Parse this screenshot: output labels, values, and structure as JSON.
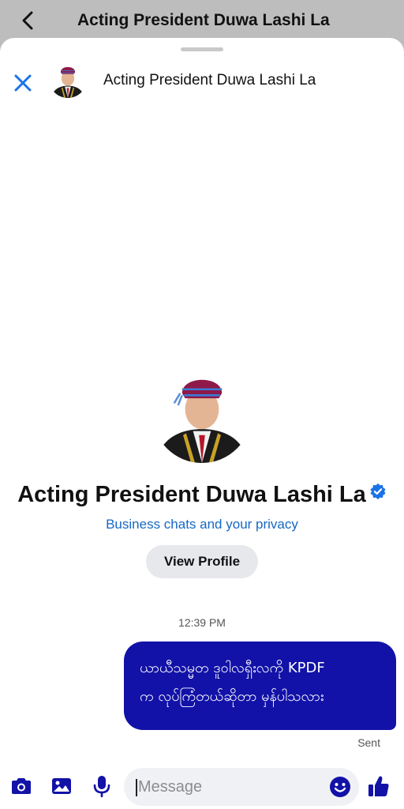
{
  "topbar": {
    "title": "Acting President Duwa Lashi La"
  },
  "header": {
    "name": "Acting President Duwa Lashi La"
  },
  "profile": {
    "name": "Acting President Duwa Lashi La",
    "privacy_link": "Business chats and your privacy",
    "view_profile_label": "View Profile"
  },
  "conversation": {
    "timestamp": "12:39 PM",
    "messages": [
      {
        "line1": "ယာယီသမ္မတ ဒူဝါလရှီးလကို KPDF",
        "line2": "က လုပ်ကြံတယ်ဆိုတာ မှန်ပါသလား",
        "status": "Sent"
      }
    ]
  },
  "composer": {
    "placeholder": "Message"
  },
  "colors": {
    "accent": "#1212a8",
    "link": "#1568c4",
    "close": "#1a73e8"
  },
  "icons": [
    "back-chevron-icon",
    "close-icon",
    "verified-badge-icon",
    "camera-icon",
    "gallery-icon",
    "microphone-icon",
    "emoji-icon",
    "thumbs-up-icon"
  ]
}
